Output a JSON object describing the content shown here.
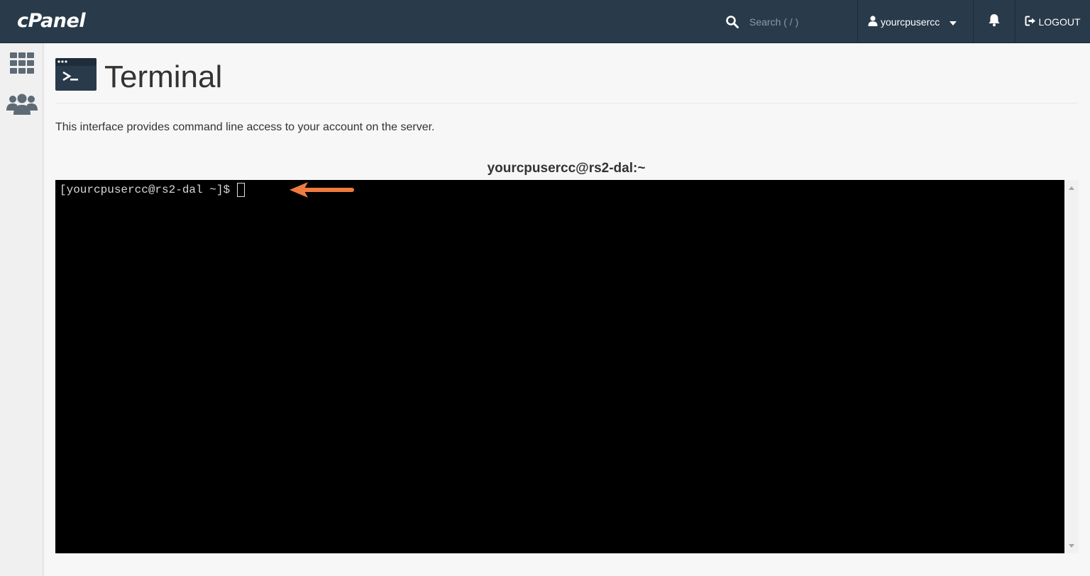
{
  "navbar": {
    "logo": "cPanel",
    "search_placeholder": "Search ( / )",
    "username": "yourcpusercc",
    "logout_label": "LOGOUT"
  },
  "sidebar": {
    "items": [
      {
        "icon": "grid-icon"
      },
      {
        "icon": "users-icon"
      }
    ]
  },
  "page": {
    "title": "Terminal",
    "description": "This interface provides command line access to your account on the server."
  },
  "terminal": {
    "window_title": "yourcpusercc@rs2-dal:~",
    "prompt": "[yourcpusercc@rs2-dal ~]$",
    "background": "#000000",
    "text_color": "#d8d8d8"
  },
  "annotation": {
    "arrow_color": "#f07b3f"
  },
  "colors": {
    "navbar_bg": "#293a4a",
    "page_bg": "#f7f7f7"
  }
}
